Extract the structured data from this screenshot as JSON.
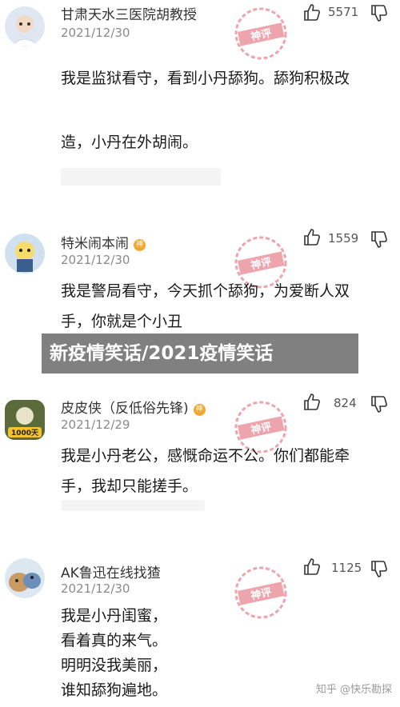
{
  "comments": [
    {
      "username": "甘肃天水三医院胡教授",
      "badge": "",
      "date": "2021/12/30",
      "likes": "5571",
      "lines": [
        "我是监狱看守，看到小丹舔狗。舔狗积极改",
        "造，小丹在外胡闹。"
      ]
    },
    {
      "username": "特米闹本闹",
      "badge": "神",
      "date": "2021/12/30",
      "likes": "1559",
      "lines": [
        "我是警局看守，今天抓个舔狗，为爱断人双",
        "手，你就是个小丑"
      ]
    },
    {
      "username": "皮皮侠（反低俗先锋)",
      "badge": "神",
      "date": "2021/12/29",
      "likes": "824",
      "lines": [
        "我是小丹老公，感慨命运不公。你们都能牵",
        "手，我却只能搓手。"
      ]
    },
    {
      "username": "AK鲁迅在线找猹",
      "badge": "",
      "date": "2021/12/30",
      "likes": "1125",
      "lines": [
        "我是小丹闺蜜，",
        "看着真的来气。",
        "明明没我美丽，",
        "谁知舔狗遍地。"
      ]
    }
  ],
  "avatar3_text": "1000天",
  "stamp_text": "神评",
  "banner": "新疫情笑话/2021疫情笑话",
  "watermark": "知乎 @快乐勘探",
  "colors": {
    "stamp": "#e05a6a",
    "badge": "#f0a830",
    "banner": "#6e6e6e"
  }
}
